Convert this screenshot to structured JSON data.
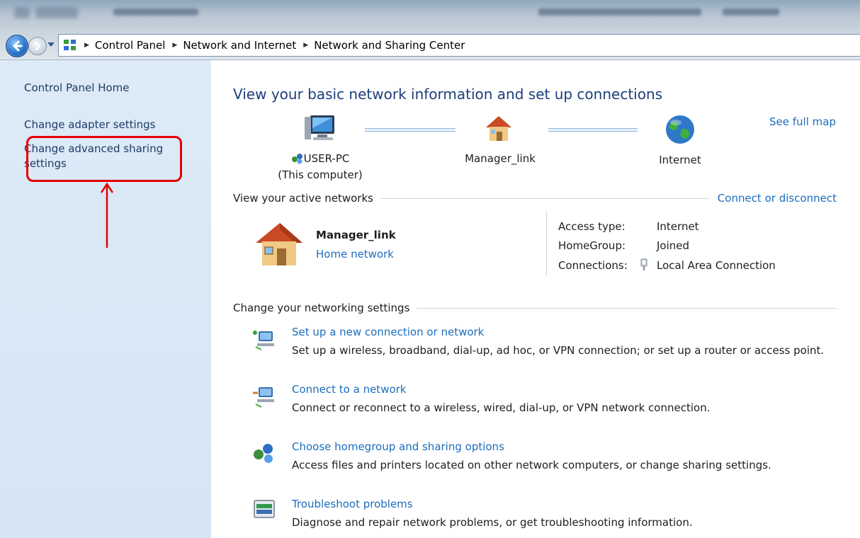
{
  "breadcrumb": [
    "Control Panel",
    "Network and Internet",
    "Network and Sharing Center"
  ],
  "left_pane": {
    "home": "Control Panel Home",
    "adapter": "Change adapter settings",
    "advanced_line1": "Change advanced sharing",
    "advanced_line2": "settings"
  },
  "main": {
    "title": "View your basic network information and set up connections",
    "see_full_map": "See full map",
    "map": {
      "computer_name": "USER-PC",
      "computer_sub": "(This computer)",
      "network_name": "Manager_link",
      "internet_label": "Internet"
    },
    "active_header": "View your active networks",
    "connect_disconnect": "Connect or disconnect",
    "network": {
      "name": "Manager_link",
      "type": "Home network",
      "access_type_label": "Access type:",
      "access_type_value": "Internet",
      "homegroup_label": "HomeGroup:",
      "homegroup_value": "Joined",
      "connections_label": "Connections:",
      "connections_value": "Local Area Connection"
    },
    "change_header": "Change your networking settings",
    "tasks": [
      {
        "link": "Set up a new connection or network",
        "desc": "Set up a wireless, broadband, dial-up, ad hoc, or VPN connection; or set up a router or access point."
      },
      {
        "link": "Connect to a network",
        "desc": "Connect or reconnect to a wireless, wired, dial-up, or VPN network connection."
      },
      {
        "link": "Choose homegroup and sharing options",
        "desc": "Access files and printers located on other network computers, or change sharing settings."
      },
      {
        "link": "Troubleshoot problems",
        "desc": "Diagnose and repair network problems, or get troubleshooting information."
      }
    ]
  },
  "colors": {
    "link": "#1c6dbd",
    "title": "#1c3f7a",
    "left_pane_bg": "#d6e5f5",
    "highlight": "#e50000"
  }
}
